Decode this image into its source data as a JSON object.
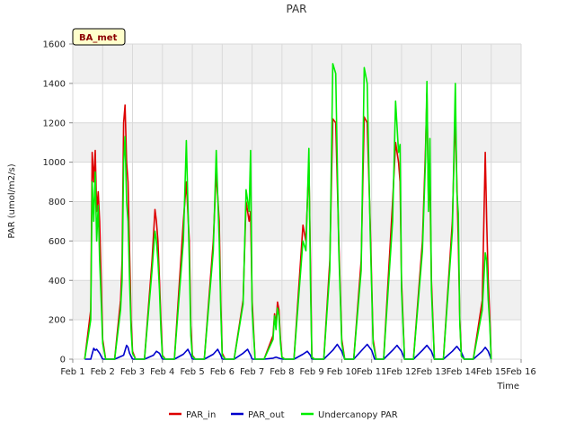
{
  "chart_data": {
    "type": "line",
    "title": "PAR",
    "xlabel": "Time",
    "ylabel": "PAR (umol/m2/s)",
    "badge": "BA_met",
    "xlim": [
      1,
      16
    ],
    "ylim": [
      0,
      1600
    ],
    "x_ticks": [
      {
        "value": 1,
        "label": "Feb 1"
      },
      {
        "value": 2,
        "label": "Feb 2"
      },
      {
        "value": 3,
        "label": "Feb 3"
      },
      {
        "value": 4,
        "label": "Feb 4"
      },
      {
        "value": 5,
        "label": "Feb 5"
      },
      {
        "value": 6,
        "label": "Feb 6"
      },
      {
        "value": 7,
        "label": "Feb 7"
      },
      {
        "value": 8,
        "label": "Feb 8"
      },
      {
        "value": 9,
        "label": "Feb 9"
      },
      {
        "value": 10,
        "label": "Feb 10"
      },
      {
        "value": 11,
        "label": "Feb 11"
      },
      {
        "value": 12,
        "label": "Feb 12"
      },
      {
        "value": 13,
        "label": "Feb 13"
      },
      {
        "value": 14,
        "label": "Feb 14"
      },
      {
        "value": 15,
        "label": "Feb 15"
      },
      {
        "value": 16,
        "label": "Feb 16"
      }
    ],
    "y_ticks": [
      0,
      200,
      400,
      600,
      800,
      1000,
      1200,
      1400,
      1600
    ],
    "grid": true,
    "legend_position": "bottom",
    "series": [
      {
        "name": "PAR_in",
        "color": "#dd0000",
        "x": [
          1.4,
          1.6,
          1.65,
          1.7,
          1.75,
          1.8,
          1.85,
          1.9,
          1.95,
          2.0,
          2.1,
          2.4,
          2.6,
          2.65,
          2.7,
          2.75,
          2.8,
          2.85,
          2.9,
          2.95,
          3.0,
          3.1,
          3.4,
          3.65,
          3.75,
          3.8,
          3.85,
          3.9,
          3.95,
          4.0,
          4.1,
          4.4,
          4.7,
          4.8,
          4.9,
          4.95,
          5.0,
          5.1,
          5.4,
          5.7,
          5.8,
          5.9,
          5.95,
          6.0,
          6.1,
          6.4,
          6.7,
          6.8,
          6.9,
          6.95,
          7.0,
          7.1,
          7.4,
          7.7,
          7.75,
          7.8,
          7.85,
          7.9,
          7.95,
          8.0,
          8.1,
          8.4,
          8.7,
          8.8,
          8.9,
          8.95,
          9.0,
          9.1,
          9.4,
          9.6,
          9.7,
          9.8,
          9.9,
          10.0,
          10.1,
          10.4,
          10.65,
          10.75,
          10.85,
          10.95,
          11.05,
          11.15,
          11.4,
          11.7,
          11.8,
          11.9,
          11.95,
          12.0,
          12.1,
          12.4,
          12.7,
          12.8,
          12.85,
          12.9,
          12.95,
          13.0,
          13.1,
          13.4,
          13.7,
          13.8,
          13.85,
          13.9,
          13.95,
          14.0,
          14.1,
          14.4,
          14.7,
          14.8,
          14.85,
          14.9,
          14.95,
          15.0
        ],
        "y": [
          0,
          250,
          1050,
          900,
          1060,
          750,
          850,
          700,
          400,
          100,
          0,
          0,
          300,
          500,
          1200,
          1290,
          1000,
          900,
          550,
          200,
          40,
          0,
          0,
          500,
          760,
          700,
          600,
          400,
          200,
          20,
          0,
          0,
          700,
          900,
          600,
          170,
          20,
          0,
          0,
          600,
          950,
          700,
          300,
          30,
          0,
          0,
          300,
          800,
          700,
          750,
          300,
          0,
          0,
          120,
          230,
          180,
          290,
          250,
          100,
          10,
          0,
          0,
          680,
          600,
          1000,
          500,
          10,
          0,
          0,
          500,
          1220,
          1200,
          600,
          100,
          0,
          0,
          500,
          1230,
          1200,
          700,
          100,
          0,
          0,
          800,
          1100,
          1000,
          900,
          400,
          0,
          0,
          600,
          1050,
          1350,
          800,
          900,
          400,
          0,
          0,
          700,
          1250,
          900,
          600,
          200,
          20,
          0,
          0,
          300,
          1050,
          700,
          400,
          220,
          0
        ]
      },
      {
        "name": "PAR_out",
        "color": "#0000cc",
        "x": [
          1.4,
          1.6,
          1.7,
          1.75,
          1.8,
          1.85,
          1.9,
          2.0,
          2.4,
          2.7,
          2.8,
          2.85,
          2.9,
          3.0,
          3.4,
          3.7,
          3.8,
          3.9,
          4.0,
          4.4,
          4.7,
          4.85,
          4.95,
          5.0,
          5.4,
          5.7,
          5.85,
          5.95,
          6.0,
          6.4,
          6.7,
          6.85,
          6.95,
          7.0,
          7.4,
          7.7,
          7.8,
          7.9,
          8.0,
          8.4,
          8.7,
          8.85,
          8.95,
          9.0,
          9.4,
          9.7,
          9.85,
          10.0,
          10.1,
          10.4,
          10.7,
          10.85,
          11.0,
          11.1,
          11.4,
          11.7,
          11.85,
          12.0,
          12.1,
          12.4,
          12.7,
          12.85,
          13.0,
          13.1,
          13.4,
          13.7,
          13.85,
          14.0,
          14.1,
          14.4,
          14.7,
          14.8,
          14.9,
          15.0
        ],
        "y": [
          0,
          0,
          55,
          45,
          50,
          40,
          30,
          0,
          0,
          20,
          70,
          60,
          30,
          0,
          0,
          20,
          40,
          30,
          0,
          0,
          25,
          50,
          20,
          0,
          0,
          25,
          50,
          20,
          0,
          0,
          30,
          50,
          20,
          0,
          0,
          5,
          10,
          5,
          0,
          0,
          25,
          40,
          20,
          0,
          0,
          45,
          75,
          40,
          0,
          0,
          50,
          75,
          45,
          0,
          0,
          45,
          70,
          40,
          0,
          0,
          45,
          70,
          40,
          0,
          0,
          40,
          65,
          35,
          0,
          0,
          40,
          60,
          40,
          0
        ]
      },
      {
        "name": "Undercanopy PAR",
        "color": "#00ee00",
        "x": [
          1.4,
          1.6,
          1.65,
          1.7,
          1.75,
          1.8,
          1.85,
          1.9,
          1.95,
          2.0,
          2.1,
          2.4,
          2.6,
          2.65,
          2.7,
          2.75,
          2.8,
          2.85,
          2.9,
          2.95,
          3.0,
          3.1,
          3.4,
          3.65,
          3.75,
          3.8,
          3.85,
          3.9,
          3.95,
          4.0,
          4.1,
          4.4,
          4.7,
          4.8,
          4.9,
          4.95,
          5.0,
          5.1,
          5.4,
          5.7,
          5.8,
          5.9,
          5.95,
          6.0,
          6.1,
          6.4,
          6.7,
          6.8,
          6.9,
          6.95,
          7.0,
          7.1,
          7.4,
          7.7,
          7.75,
          7.8,
          7.85,
          7.9,
          7.95,
          8.0,
          8.1,
          8.4,
          8.7,
          8.8,
          8.9,
          8.95,
          9.0,
          9.1,
          9.4,
          9.6,
          9.7,
          9.8,
          9.9,
          10.0,
          10.1,
          10.4,
          10.65,
          10.75,
          10.85,
          10.95,
          11.05,
          11.15,
          11.4,
          11.7,
          11.8,
          11.9,
          11.95,
          12.0,
          12.1,
          12.4,
          12.7,
          12.8,
          12.85,
          12.9,
          12.95,
          13.0,
          13.1,
          13.4,
          13.7,
          13.8,
          13.85,
          13.9,
          13.95,
          14.0,
          14.1,
          14.4,
          14.7,
          14.8,
          14.85,
          14.9,
          14.95,
          15.0
        ],
        "y": [
          0,
          200,
          900,
          700,
          950,
          600,
          780,
          500,
          300,
          80,
          0,
          0,
          250,
          400,
          1000,
          1130,
          800,
          700,
          400,
          150,
          30,
          0,
          0,
          450,
          650,
          600,
          500,
          350,
          150,
          15,
          0,
          0,
          600,
          1110,
          500,
          120,
          15,
          0,
          0,
          550,
          1060,
          600,
          250,
          20,
          0,
          0,
          280,
          860,
          750,
          1060,
          250,
          0,
          0,
          100,
          220,
          150,
          260,
          220,
          80,
          8,
          0,
          0,
          600,
          550,
          1070,
          400,
          8,
          0,
          0,
          450,
          1500,
          1450,
          550,
          80,
          0,
          0,
          450,
          1480,
          1400,
          650,
          80,
          0,
          0,
          700,
          1310,
          1050,
          1090,
          350,
          0,
          0,
          550,
          1000,
          1410,
          750,
          1120,
          350,
          0,
          0,
          650,
          1400,
          850,
          740,
          180,
          15,
          0,
          0,
          250,
          540,
          500,
          300,
          180,
          0
        ]
      }
    ]
  }
}
